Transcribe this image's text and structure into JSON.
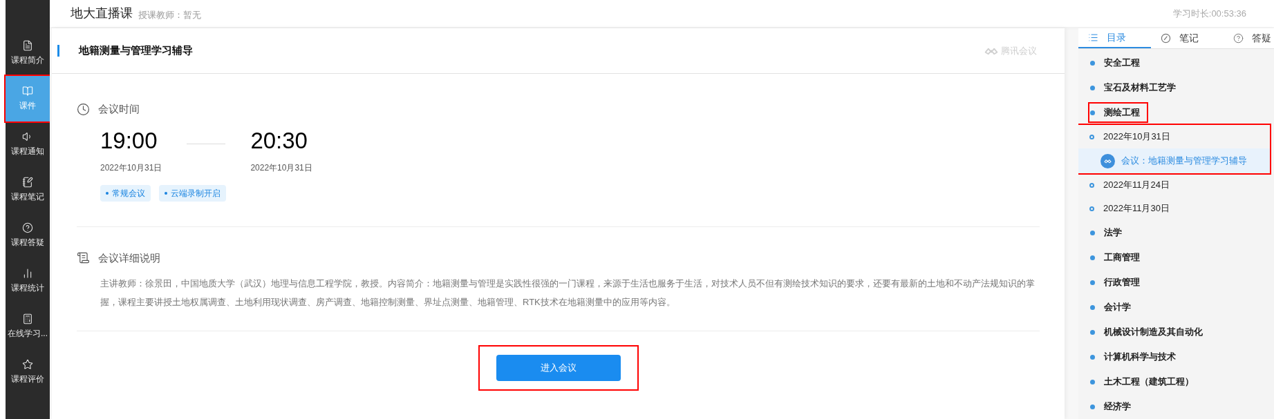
{
  "header": {
    "title": "地大直播课",
    "teacher": "授课教师：暂无",
    "study_time": "学习时长:00:53:36"
  },
  "sidebar": {
    "items": [
      {
        "label": "课程简介",
        "kind": "intro",
        "selected": false,
        "highlighted": false
      },
      {
        "label": "课件",
        "kind": "courseware",
        "selected": true,
        "highlighted": true
      },
      {
        "label": "课程通知",
        "kind": "notice",
        "selected": false,
        "highlighted": false
      },
      {
        "label": "课程笔记",
        "kind": "notes",
        "selected": false,
        "highlighted": false
      },
      {
        "label": "课程答疑",
        "kind": "qa",
        "selected": false,
        "highlighted": false
      },
      {
        "label": "课程统计",
        "kind": "stats",
        "selected": false,
        "highlighted": false
      },
      {
        "label": "在线学习...",
        "kind": "online",
        "selected": false,
        "highlighted": false
      },
      {
        "label": "课程评价",
        "kind": "rating",
        "selected": false,
        "highlighted": false
      }
    ]
  },
  "meeting": {
    "title": "地籍测量与管理学习辅导",
    "brand": "腾讯会议",
    "time_section": {
      "heading": "会议时间",
      "start_time": "19:00",
      "start_date": "2022年10月31日",
      "end_time": "20:30",
      "end_date": "2022年10月31日",
      "tags": [
        "常规会议",
        "云端录制开启"
      ]
    },
    "detail_section": {
      "heading": "会议详细说明",
      "text": "主讲教师：徐景田，中国地质大学（武汉）地理与信息工程学院，教授。内容简介：地籍测量与管理是实践性很强的一门课程，来源于生活也服务于生活，对技术人员不但有测绘技术知识的要求，还要有最新的土地和不动产法规知识的掌握，课程主要讲授土地权属调查、土地利用现状调查、房产调查、地籍控制测量、界址点测量、地籍管理、RTK技术在地籍测量中的应用等内容。"
    },
    "enter_button": {
      "label": "进入会议",
      "highlighted": true
    }
  },
  "right_panel": {
    "tabs": [
      {
        "label": "目录",
        "kind": "catalog",
        "selected": true
      },
      {
        "label": "笔记",
        "kind": "notes",
        "selected": false
      },
      {
        "label": "答疑",
        "kind": "qa",
        "selected": false
      }
    ],
    "catalog": [
      {
        "label": "安全工程",
        "kind": "subject",
        "highlighted": false
      },
      {
        "label": "宝石及材料工艺学",
        "kind": "subject",
        "highlighted": false
      },
      {
        "label": "测绘工程",
        "kind": "subject",
        "highlighted": true
      },
      {
        "label": "2022年10月31日",
        "kind": "date",
        "highlighted": true,
        "children": [
          {
            "label": "会议：地籍测量与管理学习辅导",
            "kind": "meeting",
            "selected": true
          }
        ]
      },
      {
        "label": "2022年11月24日",
        "kind": "date",
        "highlighted": false
      },
      {
        "label": "2022年11月30日",
        "kind": "date",
        "highlighted": false
      },
      {
        "label": "法学",
        "kind": "subject",
        "highlighted": false
      },
      {
        "label": "工商管理",
        "kind": "subject",
        "highlighted": false
      },
      {
        "label": "行政管理",
        "kind": "subject",
        "highlighted": false
      },
      {
        "label": "会计学",
        "kind": "subject",
        "highlighted": false
      },
      {
        "label": "机械设计制造及其自动化",
        "kind": "subject",
        "highlighted": false
      },
      {
        "label": "计算机科学与技术",
        "kind": "subject",
        "highlighted": false
      },
      {
        "label": "土木工程（建筑工程）",
        "kind": "subject",
        "highlighted": false
      },
      {
        "label": "经济学",
        "kind": "subject",
        "highlighted": false
      }
    ]
  }
}
